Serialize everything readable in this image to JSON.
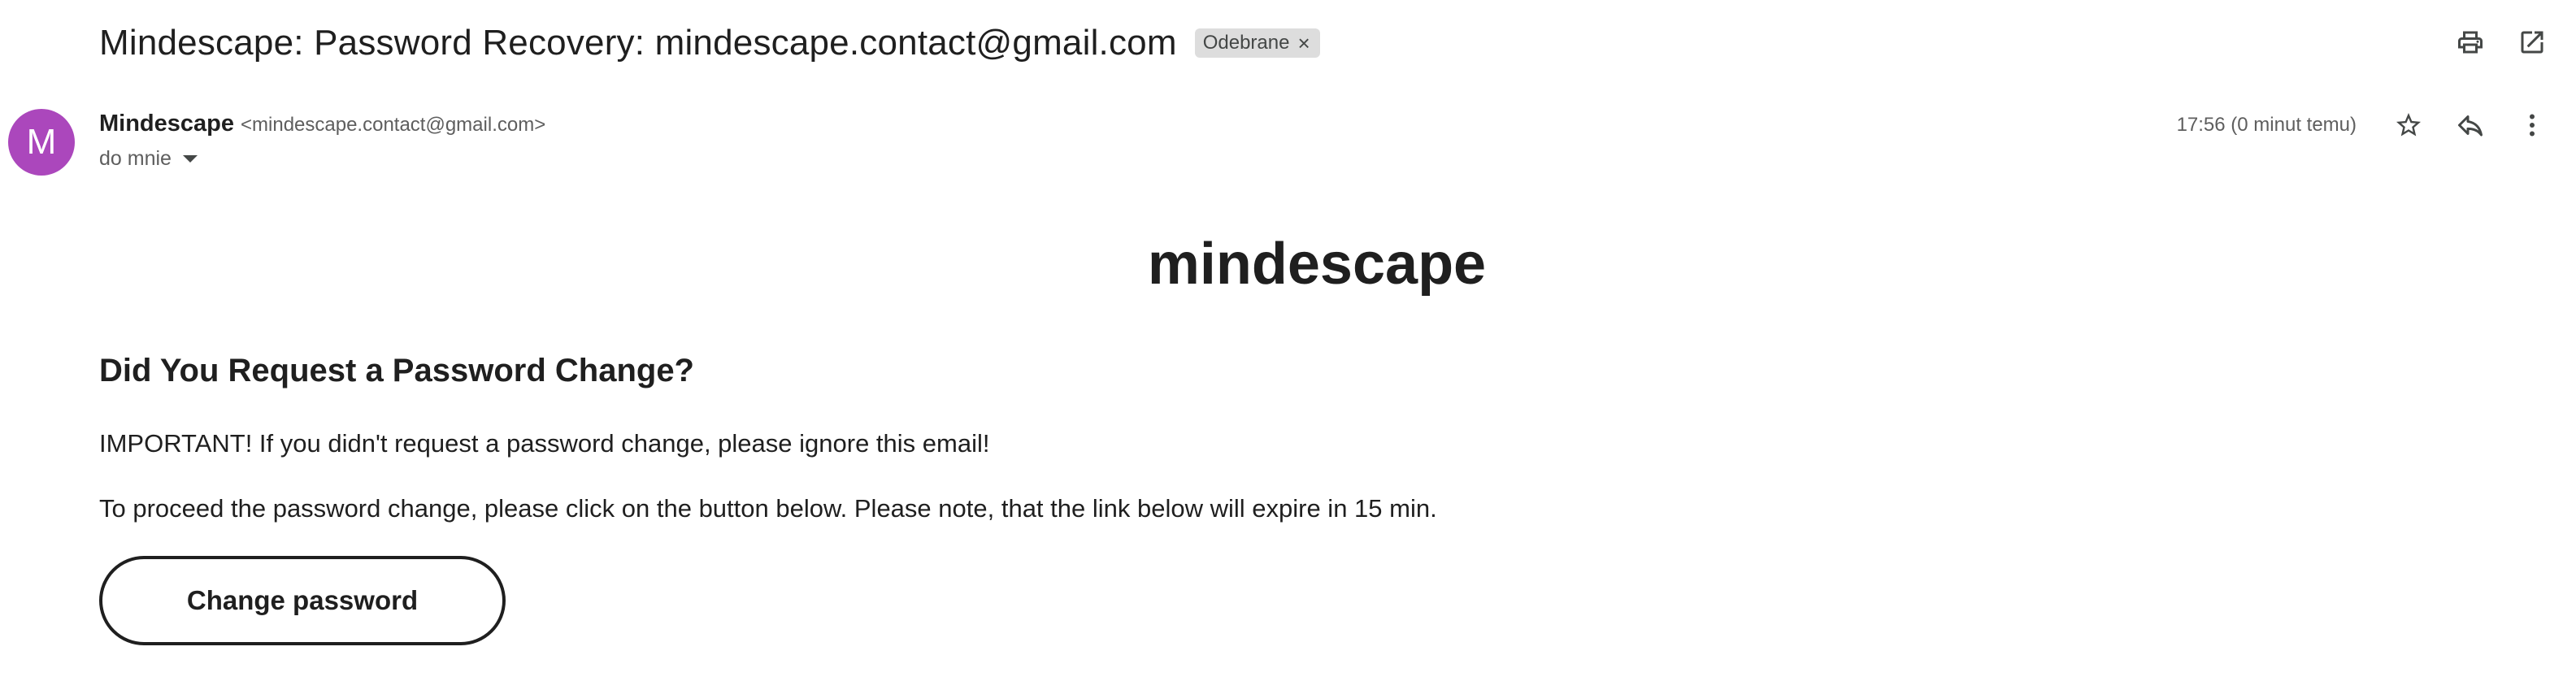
{
  "email": {
    "subject": "Mindescape: Password Recovery: mindescape.contact@gmail.com",
    "label": "Odebrane",
    "label_remove": "×",
    "sender": {
      "avatar_letter": "M",
      "name": "Mindescape",
      "email": "<mindescape.contact@gmail.com>",
      "recipient": "do mnie"
    },
    "timestamp": "17:56 (0 minut temu)"
  },
  "toolbar": {
    "icons": [
      "print-icon",
      "open-in-new-window-icon",
      "star-icon",
      "reply-icon",
      "more-vert-icon"
    ]
  },
  "body": {
    "brand": "mindescape",
    "title": "Did You Request a Password Change?",
    "paragraph1": "IMPORTANT! If you didn't request a password change, please ignore this email!",
    "paragraph2": "To proceed the password change, please click on the button below. Please note, that the link below will expire in 15 min.",
    "button_label": "Change password"
  },
  "colors": {
    "avatar_bg": "#ab47bc",
    "label_chip_bg": "#dddddd",
    "text": "#1f1f1f",
    "muted": "#5e5e5e"
  }
}
